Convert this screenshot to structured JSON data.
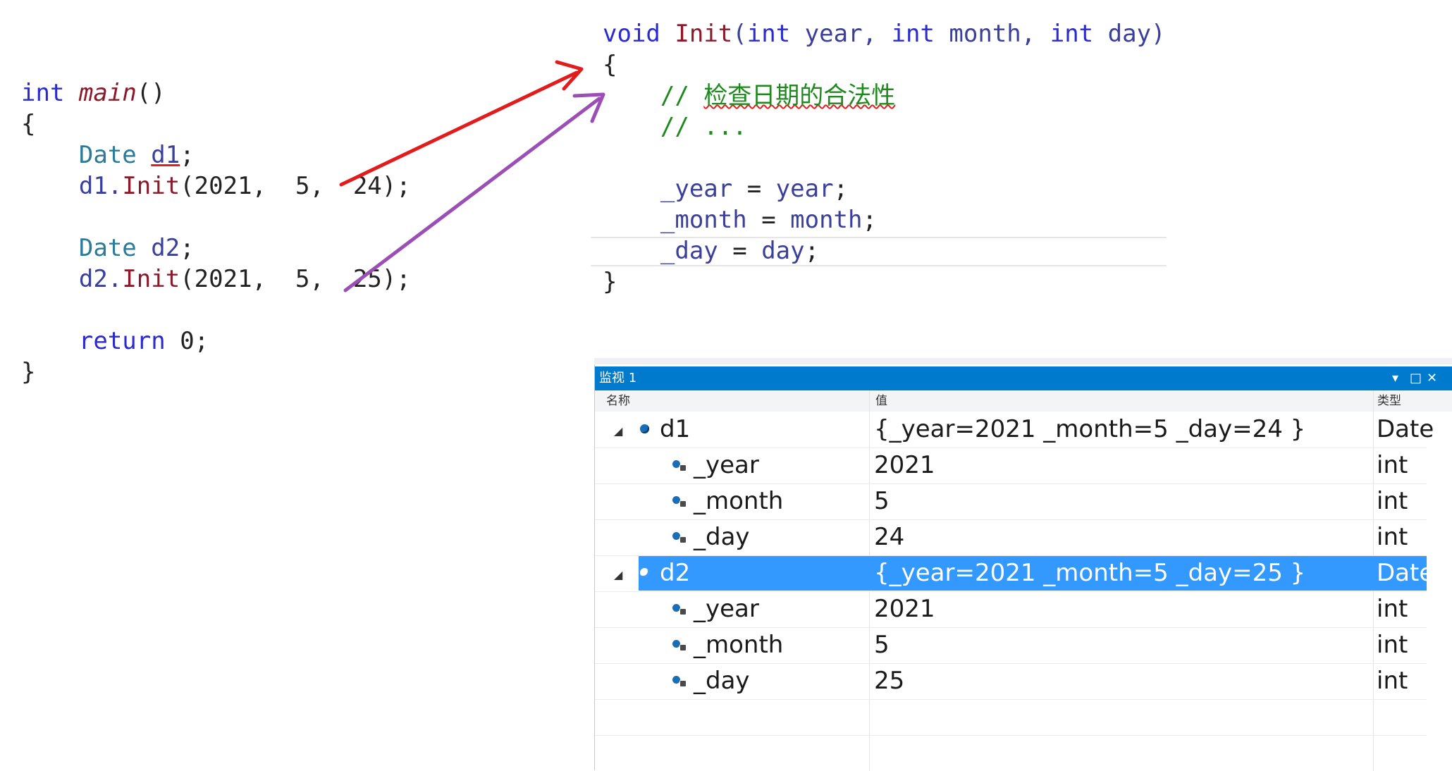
{
  "left_code": {
    "l1_kw": "int",
    "l1_fn": "main",
    "l1_rest": "()",
    "l2": "{",
    "l3_type": "Date",
    "l3_var": "d1",
    "l3_end": ";",
    "l4_var": "d1.",
    "l4_fn": "Init",
    "l4_args": "(2021,  5,  24);",
    "l6_type": "Date",
    "l6_var": "d2",
    "l6_end": ";",
    "l7_var": "d2.",
    "l7_fn": "Init",
    "l7_args": "(2021,  5,  25);",
    "l9_kw": "return",
    "l9_rest": " 0;",
    "l10": "}"
  },
  "right_code": {
    "l1_kw": "void",
    "l1_fn": "Init",
    "l1_p1": "(",
    "l1_int1": "int",
    "l1_year": "year,",
    "l1_int2": "int",
    "l1_month": "month,",
    "l1_int3": "int",
    "l1_day": "day)",
    "l2": "{",
    "l3_slash": "// ",
    "l3_comment": "检查日期的合法性",
    "l4_comment": "// ...",
    "l6_lhs": "_year",
    "l6_eq": " = ",
    "l6_rhs": "year",
    "l6_end": ";",
    "l7_lhs": "_month",
    "l7_eq": " = ",
    "l7_rhs": "month",
    "l7_end": ";",
    "l8_lhs": "_day",
    "l8_eq": " = ",
    "l8_rhs": "day",
    "l8_end": ";",
    "l9": "}"
  },
  "watch": {
    "title": "监视 1",
    "controls": {
      "dropdown": "▾",
      "maximize": "□",
      "close": "✕"
    },
    "headers": {
      "name": "名称",
      "value": "值",
      "type": "类型"
    },
    "rows": [
      {
        "name": "d1",
        "value": "{_year=2021 _month=5 _day=24 }",
        "type": "Date",
        "expander": "◢"
      },
      {
        "name": "_year",
        "value": "2021",
        "type": "int"
      },
      {
        "name": "_month",
        "value": "5",
        "type": "int"
      },
      {
        "name": "_day",
        "value": "24",
        "type": "int"
      },
      {
        "name": "d2",
        "value": "{_year=2021 _month=5 _day=25 }",
        "type": "Date",
        "expander": "◢"
      },
      {
        "name": "_year",
        "value": "2021",
        "type": "int"
      },
      {
        "name": "_month",
        "value": "5",
        "type": "int"
      },
      {
        "name": "_day",
        "value": "25",
        "type": "int"
      }
    ]
  },
  "colors": {
    "arrow_red": "#e21c1c",
    "arrow_purple": "#9b4fb5",
    "watch_title_bg": "#007acc",
    "selected_row_bg": "#3399ff"
  }
}
